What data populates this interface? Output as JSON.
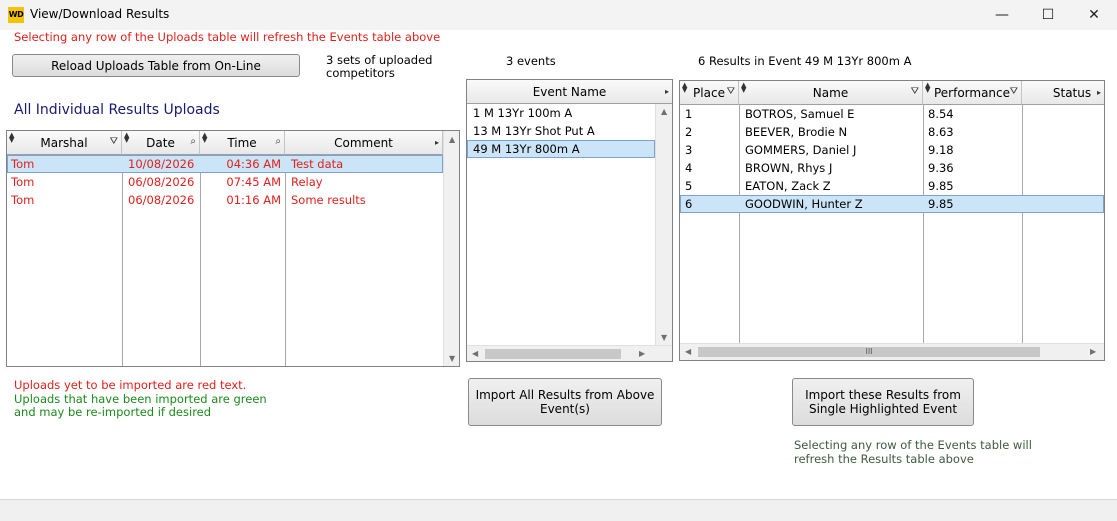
{
  "window": {
    "title": "View/Download Results",
    "icon_text": "WD",
    "minimize": "—",
    "maximize": "☐",
    "close": "✕"
  },
  "hint_top": "Selecting any row of the Uploads table will refresh the Events table above",
  "reload_button": "Reload Uploads Table from On-Line",
  "uploads_count": "3 sets of uploaded competitors",
  "events_count": "3 events",
  "results_count": "6  Results in Event 49 M 13Yr 800m A",
  "uploads_title": "All Individual Results Uploads",
  "uploads_table": {
    "headers": [
      "Marshal",
      "Date",
      "Time",
      "Comment"
    ],
    "rows": [
      {
        "marshal": "Tom",
        "date": "10/08/2026",
        "time": "04:36 AM",
        "comment": "Test data"
      },
      {
        "marshal": "Tom",
        "date": "06/08/2026",
        "time": "07:45 AM",
        "comment": "Relay"
      },
      {
        "marshal": "Tom",
        "date": "06/08/2026",
        "time": "01:16 AM",
        "comment": "Some results"
      }
    ]
  },
  "events_table": {
    "header": "Event Name",
    "rows": [
      "1 M 13Yr 100m A",
      "13 M 13Yr Shot Put A",
      "49 M 13Yr 800m A"
    ]
  },
  "results_table": {
    "headers": [
      "Place",
      "Name",
      "Performance",
      "Status"
    ],
    "rows": [
      {
        "place": "1",
        "name": "BOTROS, Samuel E",
        "perf": "8.54"
      },
      {
        "place": "2",
        "name": "BEEVER, Brodie N",
        "perf": "8.63"
      },
      {
        "place": "3",
        "name": "GOMMERS, Daniel J",
        "perf": "9.18"
      },
      {
        "place": "4",
        "name": "BROWN, Rhys J",
        "perf": "9.36"
      },
      {
        "place": "5",
        "name": "EATON, Zack Z",
        "perf": "9.85"
      },
      {
        "place": "6",
        "name": "GOODWIN, Hunter Z",
        "perf": "9.85"
      }
    ]
  },
  "legend": {
    "red_text": "Uploads yet to be imported are red text.",
    "green_text_1": "Uploads that have been imported are green",
    "green_text_2": "and may be re-imported if desired"
  },
  "import_all_button": {
    "line1": "Import All Results from Above",
    "line2": "Event(s)"
  },
  "import_single_button": {
    "line1": "Import these Results from",
    "line2": "Single Highlighted Event"
  },
  "hint_bottom": {
    "line1": "Selecting any row of the Events table will",
    "line2": "refresh the Results table above"
  },
  "icons": {
    "scroll_grip": "III"
  },
  "colors": {
    "red": "#e0201c",
    "green": "#1c8a1c",
    "selection": "#cce4f7"
  }
}
